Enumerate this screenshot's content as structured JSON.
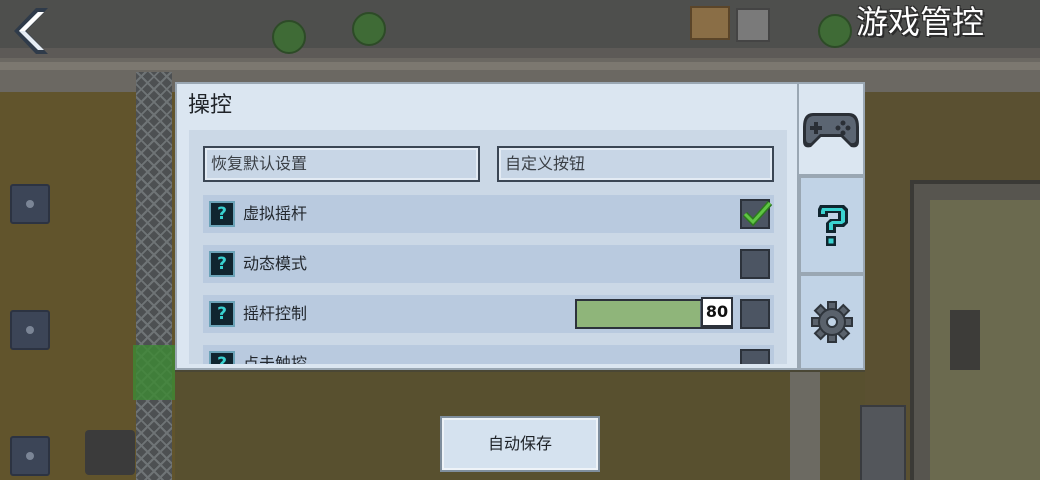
{
  "header": {
    "title": "游戏管控",
    "back_icon": "back-arrow-icon"
  },
  "panel": {
    "title": "操控",
    "buttons": {
      "restore_defaults": "恢复默认设置",
      "custom_buttons": "自定义按钮"
    },
    "settings": [
      {
        "label": "虚拟摇杆",
        "type": "checkbox",
        "checked": true
      },
      {
        "label": "动态模式",
        "type": "checkbox",
        "checked": false
      },
      {
        "label": "摇杆控制",
        "type": "slider",
        "value": "80",
        "max": 100,
        "checked": false
      },
      {
        "label": "点击触控",
        "type": "checkbox",
        "checked": false
      }
    ],
    "help_symbol": "?"
  },
  "tabs": [
    {
      "name": "controller",
      "icon": "gamepad-icon",
      "active": true
    },
    {
      "name": "help",
      "icon": "question-mark-icon",
      "active": false
    },
    {
      "name": "settings",
      "icon": "gear-icon",
      "active": false
    }
  ],
  "footer": {
    "autosave_label": "自动保存"
  },
  "colors": {
    "panel_bg": "#dbe6f1",
    "row_bg": "#b9cadf",
    "check_green": "#4caf37",
    "help_cyan": "#3ad2d0",
    "slider_fill": "#8fb57a"
  }
}
